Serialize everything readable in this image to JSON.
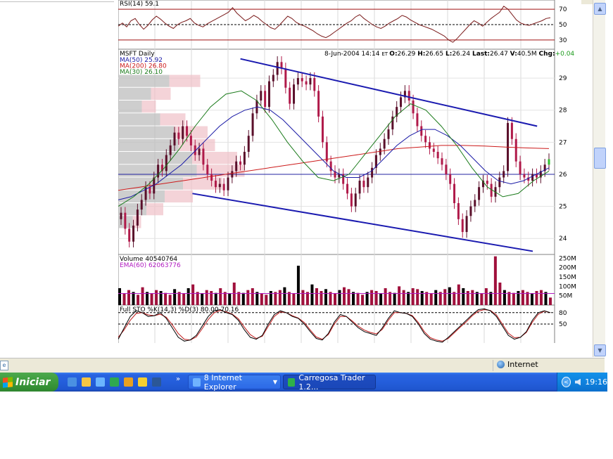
{
  "chart_data": [
    {
      "type": "line",
      "panel": "rsi",
      "title": "RSI(14) 59.1",
      "reference_lines": [
        70,
        50,
        30
      ],
      "y_ticks": [
        70,
        50,
        30
      ],
      "ylim": [
        18,
        82
      ],
      "values": [
        48,
        52,
        47,
        55,
        58,
        50,
        44,
        49,
        56,
        61,
        57,
        52,
        48,
        45,
        50,
        53,
        55,
        58,
        52,
        49,
        47,
        51,
        54,
        57,
        60,
        63,
        66,
        72,
        65,
        60,
        55,
        58,
        62,
        59,
        54,
        50,
        46,
        44,
        49,
        55,
        61,
        58,
        53,
        50,
        48,
        45,
        42,
        38,
        35,
        33,
        36,
        40,
        44,
        48,
        52,
        55,
        60,
        63,
        58,
        54,
        50,
        47,
        45,
        48,
        52,
        55,
        58,
        62,
        60,
        56,
        53,
        50,
        48,
        46,
        44,
        41,
        38,
        35,
        30,
        27,
        32,
        38,
        44,
        50,
        55,
        52,
        48,
        53,
        58,
        62,
        66,
        74,
        70,
        63,
        56,
        52,
        50,
        49,
        51,
        53,
        55,
        58,
        59
      ]
    },
    {
      "type": "candlestick",
      "panel": "price",
      "title": "MSFT Daily",
      "legend": [
        {
          "name": "MA(50) 25.92",
          "color": "#1a1aa6"
        },
        {
          "name": "MA(200) 26.80",
          "color": "#cc1a1a"
        },
        {
          "name": "MA(30) 26.10",
          "color": "#1a7a1a"
        }
      ],
      "info": {
        "date_label": "8-Jun-2004 14:14",
        "tz": "ET",
        "open_label": "O:",
        "open": "26.29",
        "high_label": "H:",
        "high": "26.65",
        "low_label": "L:",
        "low": "26.24",
        "last_label": "Last:",
        "last": "26.47",
        "volume_label": "V:",
        "volume": "40.5M",
        "change_label": "Chg:",
        "change": "+0.04"
      },
      "y_ticks": [
        29,
        28,
        27,
        26,
        25,
        24
      ],
      "ylim": [
        23.5,
        29.9
      ],
      "closes": [
        24.8,
        24.3,
        23.9,
        24.4,
        24.9,
        25.2,
        25.6,
        25.4,
        25.9,
        26.3,
        26.1,
        26.6,
        26.9,
        27.3,
        27.1,
        27.5,
        27.2,
        26.9,
        26.6,
        26.8,
        26.3,
        26.0,
        25.8,
        25.6,
        25.7,
        25.5,
        25.9,
        26.1,
        26.4,
        26.3,
        26.7,
        27.2,
        27.9,
        28.3,
        28.6,
        28.1,
        28.9,
        29.1,
        29.5,
        29.3,
        28.7,
        28.2,
        28.8,
        29.0,
        28.9,
        28.8,
        29.0,
        28.6,
        27.8,
        27.0,
        26.4,
        26.1,
        25.9,
        26.0,
        25.7,
        25.4,
        25.0,
        25.4,
        25.8,
        25.6,
        25.9,
        26.2,
        26.6,
        26.8,
        27.1,
        27.4,
        27.8,
        28.1,
        28.4,
        28.6,
        28.3,
        27.9,
        27.5,
        27.2,
        27.0,
        26.8,
        26.7,
        26.5,
        26.3,
        26.0,
        25.7,
        25.1,
        24.6,
        24.2,
        24.7,
        25.0,
        25.2,
        25.6,
        25.8,
        25.7,
        25.3,
        25.6,
        25.9,
        26.1,
        27.6,
        27.1,
        26.4,
        26.0,
        25.9,
        25.8,
        26.0,
        25.9,
        26.1,
        26.3,
        26.47
      ],
      "ma50": [
        25.2,
        25.3,
        25.5,
        25.7,
        26.0,
        26.3,
        26.7,
        27.1,
        27.5,
        27.8,
        28.0,
        28.1,
        28.0,
        27.7,
        27.3,
        26.9,
        26.5,
        26.1,
        25.9,
        25.9,
        26.1,
        26.5,
        26.9,
        27.2,
        27.4,
        27.4,
        27.2,
        26.9,
        26.5,
        26.1,
        25.8,
        25.7,
        25.8,
        26.0,
        26.2
      ],
      "ma200": [
        25.5,
        25.6,
        25.7,
        25.8,
        25.9,
        26.0,
        26.1,
        26.2,
        26.3,
        26.4,
        26.5,
        26.6,
        26.7,
        26.8,
        26.85,
        26.9,
        26.9,
        26.88,
        26.85,
        26.82,
        26.8
      ],
      "ma30": [
        25.0,
        25.3,
        25.7,
        26.2,
        26.8,
        27.5,
        28.1,
        28.5,
        28.6,
        28.3,
        27.7,
        27.0,
        26.4,
        25.9,
        25.8,
        26.0,
        26.6,
        27.2,
        27.8,
        28.2,
        28.0,
        27.5,
        26.9,
        26.2,
        25.6,
        25.3,
        25.4,
        25.8,
        26.1
      ],
      "horizontal_line": 26.0,
      "trendlines": [
        {
          "from": [
            0.28,
            29.6
          ],
          "to": [
            0.96,
            27.5
          ]
        },
        {
          "from": [
            0.17,
            25.4
          ],
          "to": [
            0.95,
            23.6
          ]
        }
      ]
    },
    {
      "type": "bar",
      "panel": "volume",
      "title": "Volume 40540764",
      "legend": [
        {
          "name": "EMA(60) 62063776",
          "color": "#b01ac0"
        }
      ],
      "y_ticks_label": [
        "250M",
        "200M",
        "150M",
        "100M",
        "50M"
      ],
      "y_ticks": [
        250,
        200,
        150,
        100,
        50
      ],
      "ylim": [
        0,
        270
      ],
      "values": [
        90,
        60,
        80,
        70,
        55,
        95,
        70,
        60,
        80,
        75,
        65,
        55,
        85,
        70,
        60,
        90,
        110,
        70,
        60,
        80,
        75,
        65,
        90,
        70,
        60,
        120,
        70,
        65,
        80,
        90,
        70,
        60,
        55,
        75,
        70,
        80,
        95,
        70,
        60,
        210,
        80,
        70,
        110,
        90,
        75,
        85,
        70,
        60,
        80,
        95,
        85,
        70,
        65,
        55,
        70,
        80,
        75,
        60,
        90,
        70,
        65,
        100,
        80,
        70,
        90,
        85,
        75,
        70,
        60,
        80,
        70,
        85,
        95,
        70,
        110,
        90,
        75,
        80,
        70,
        60,
        90,
        70,
        260,
        120,
        80,
        70,
        65,
        75,
        80,
        70,
        60,
        75,
        80,
        70,
        40
      ]
    },
    {
      "type": "line",
      "panel": "stochastic",
      "title": "Full STO %K(14,3) %D(3) 80.00 70.16",
      "y_ticks": [
        80,
        50
      ],
      "ylim": [
        0,
        100
      ],
      "k": [
        10,
        40,
        70,
        85,
        80,
        70,
        72,
        80,
        65,
        40,
        15,
        5,
        8,
        20,
        45,
        70,
        85,
        88,
        80,
        75,
        60,
        35,
        15,
        10,
        20,
        50,
        75,
        85,
        80,
        70,
        65,
        50,
        30,
        12,
        8,
        25,
        55,
        75,
        70,
        55,
        40,
        30,
        25,
        20,
        40,
        65,
        85,
        80,
        78,
        70,
        50,
        25,
        10,
        5,
        2,
        15,
        30,
        45,
        60,
        75,
        88,
        90,
        85,
        70,
        45,
        20,
        10,
        15,
        30,
        60,
        80,
        85,
        80
      ],
      "d": [
        15,
        35,
        60,
        78,
        80,
        74,
        72,
        76,
        68,
        48,
        25,
        10,
        8,
        16,
        38,
        62,
        80,
        86,
        82,
        76,
        64,
        42,
        22,
        12,
        18,
        44,
        70,
        82,
        80,
        72,
        66,
        54,
        34,
        16,
        10,
        22,
        50,
        70,
        70,
        58,
        44,
        34,
        28,
        24,
        36,
        60,
        80,
        80,
        78,
        72,
        54,
        30,
        14,
        8,
        5,
        12,
        27,
        42,
        56,
        72,
        84,
        88,
        86,
        74,
        50,
        26,
        14,
        15,
        28,
        55,
        76,
        84,
        80
      ]
    }
  ],
  "statusbar": {
    "zone_label": "Internet"
  },
  "taskbar": {
    "start_label": "Iniciar",
    "tasks": [
      {
        "label": "8 Internet Explorer",
        "color": "#3c7fef"
      },
      {
        "label": "Carregosa Trader 1.2...",
        "color": "#1a47b8"
      }
    ],
    "quick_launch_icons": [
      "desktop-icon",
      "folder-icon",
      "network-icon",
      "spreadsheet-icon",
      "media-player-icon",
      "chat-icon",
      "word-icon"
    ],
    "clock": "19:16"
  }
}
